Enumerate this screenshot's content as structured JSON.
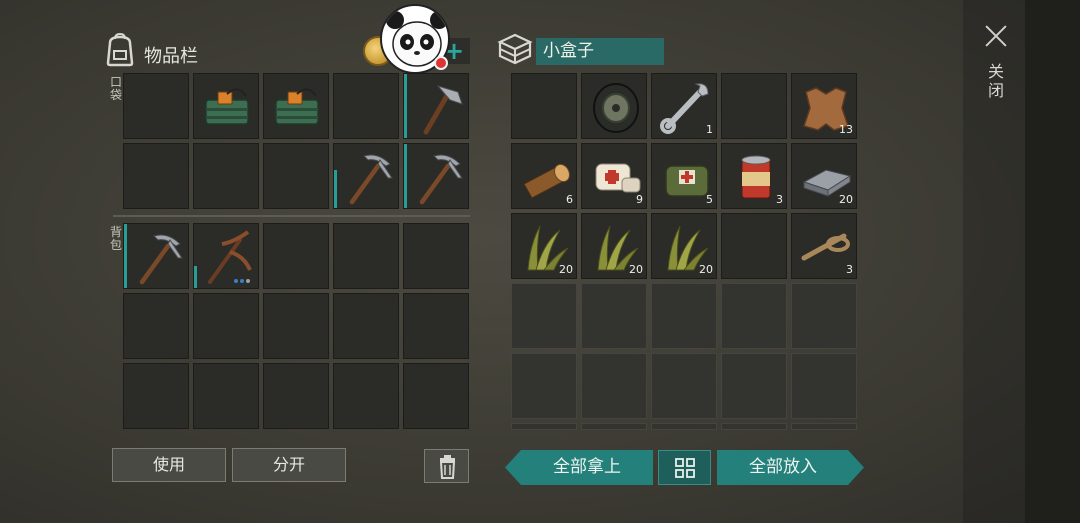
{
  "inventory": {
    "title": "物品栏",
    "pocket_label": "口袋",
    "backpack_label": "背包",
    "pocket_rows": [
      [
        {
          "item": ""
        },
        {
          "item": "explosive-crate-icon"
        },
        {
          "item": "explosive-crate-icon"
        },
        {
          "item": ""
        },
        {
          "item": "hatchet-icon",
          "durability": 1.0
        }
      ],
      [
        {
          "item": ""
        },
        {
          "item": ""
        },
        {
          "item": ""
        },
        {
          "item": "pickaxe-icon",
          "durability": 0.6
        },
        {
          "item": "pickaxe-icon",
          "durability": 1.0
        }
      ]
    ],
    "backpack_rows": [
      [
        {
          "item": "pickaxe-icon",
          "durability": 1.0
        },
        {
          "item": "bone-pickaxe-icon",
          "durability": 0.35,
          "dots": 3
        },
        {
          "item": ""
        },
        {
          "item": ""
        },
        {
          "item": ""
        }
      ],
      [
        {
          "item": ""
        },
        {
          "item": ""
        },
        {
          "item": ""
        },
        {
          "item": ""
        },
        {
          "item": ""
        }
      ],
      [
        {
          "item": ""
        },
        {
          "item": ""
        },
        {
          "item": ""
        },
        {
          "item": ""
        },
        {
          "item": ""
        }
      ]
    ],
    "use_label": "使用",
    "split_label": "分开",
    "trash_icon": "trash-icon"
  },
  "chest": {
    "name": "小盒子",
    "take_all_label": "全部拿上",
    "put_all_label": "全部放入",
    "slots": [
      [
        {
          "item": ""
        },
        {
          "item": "wheel-icon"
        },
        {
          "item": "wrench-icon",
          "count": "1"
        },
        {
          "item": ""
        },
        {
          "item": "leather-icon",
          "count": "13"
        }
      ],
      [
        {
          "item": "log-icon",
          "count": "6"
        },
        {
          "item": "bandage-icon",
          "count": "9"
        },
        {
          "item": "first-aid-bag-icon",
          "count": "5"
        },
        {
          "item": "canned-food-icon",
          "count": "3"
        },
        {
          "item": "iron-bar-icon",
          "count": "20"
        }
      ],
      [
        {
          "item": "plant-fiber-icon",
          "count": "20"
        },
        {
          "item": "plant-fiber-icon",
          "count": "20"
        },
        {
          "item": "plant-fiber-icon",
          "count": "20"
        },
        {
          "item": ""
        },
        {
          "item": "rope-icon",
          "count": "3"
        }
      ]
    ],
    "empty_rows": 3
  },
  "close_label": "关闭",
  "colors": {
    "accent": "#23807a",
    "durability": "#2a9e96"
  }
}
